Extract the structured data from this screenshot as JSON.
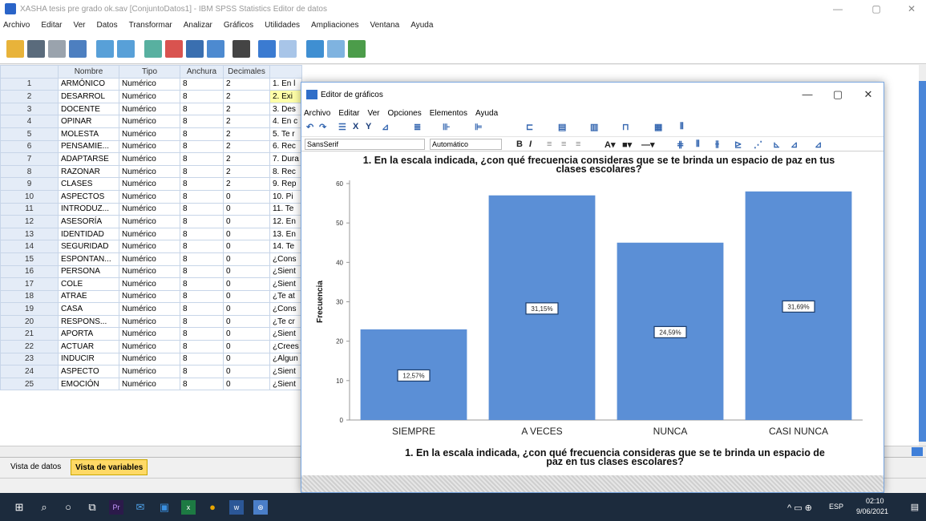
{
  "window": {
    "title": "XASHA tesis pre grado ok.sav [ConjuntoDatos1] - IBM SPSS Statistics Editor de datos",
    "menu": [
      "Archivo",
      "Editar",
      "Ver",
      "Datos",
      "Transformar",
      "Analizar",
      "Gráficos",
      "Utilidades",
      "Ampliaciones",
      "Ventana",
      "Ayuda"
    ]
  },
  "grid": {
    "columns": [
      "Nombre",
      "Tipo",
      "Anchura",
      "Decimales"
    ],
    "rows": [
      {
        "n": "1",
        "name": "ARMÓNICO",
        "type": "Numérico",
        "width": "8",
        "dec": "2",
        "label": "1. En l"
      },
      {
        "n": "2",
        "name": "DESARROL",
        "type": "Numérico",
        "width": "8",
        "dec": "2",
        "label": "2. Exi"
      },
      {
        "n": "3",
        "name": "DOCENTE",
        "type": "Numérico",
        "width": "8",
        "dec": "2",
        "label": "3. Des"
      },
      {
        "n": "4",
        "name": "OPINAR",
        "type": "Numérico",
        "width": "8",
        "dec": "2",
        "label": "4. En c"
      },
      {
        "n": "5",
        "name": "MOLESTA",
        "type": "Numérico",
        "width": "8",
        "dec": "2",
        "label": "5. Te r"
      },
      {
        "n": "6",
        "name": "PENSAMIE...",
        "type": "Numérico",
        "width": "8",
        "dec": "2",
        "label": "6. Rec"
      },
      {
        "n": "7",
        "name": "ADAPTARSE",
        "type": "Numérico",
        "width": "8",
        "dec": "2",
        "label": "7. Dura"
      },
      {
        "n": "8",
        "name": "RAZONAR",
        "type": "Numérico",
        "width": "8",
        "dec": "2",
        "label": "8. Rec"
      },
      {
        "n": "9",
        "name": "CLASES",
        "type": "Numérico",
        "width": "8",
        "dec": "2",
        "label": "9. Rep"
      },
      {
        "n": "10",
        "name": "ASPECTOS",
        "type": "Numérico",
        "width": "8",
        "dec": "0",
        "label": "10. Pi"
      },
      {
        "n": "11",
        "name": "INTRODUZ...",
        "type": "Numérico",
        "width": "8",
        "dec": "0",
        "label": "11. Te"
      },
      {
        "n": "12",
        "name": "ASESORÍA",
        "type": "Numérico",
        "width": "8",
        "dec": "0",
        "label": "12. En"
      },
      {
        "n": "13",
        "name": "IDENTIDAD",
        "type": "Numérico",
        "width": "8",
        "dec": "0",
        "label": "13. En"
      },
      {
        "n": "14",
        "name": "SEGURIDAD",
        "type": "Numérico",
        "width": "8",
        "dec": "0",
        "label": "14. Te"
      },
      {
        "n": "15",
        "name": "ESPONTAN...",
        "type": "Numérico",
        "width": "8",
        "dec": "0",
        "label": "¿Cons"
      },
      {
        "n": "16",
        "name": "PERSONA",
        "type": "Numérico",
        "width": "8",
        "dec": "0",
        "label": "¿Sient"
      },
      {
        "n": "17",
        "name": "COLE",
        "type": "Numérico",
        "width": "8",
        "dec": "0",
        "label": "¿Sient"
      },
      {
        "n": "18",
        "name": "ATRAE",
        "type": "Numérico",
        "width": "8",
        "dec": "0",
        "label": "¿Te at"
      },
      {
        "n": "19",
        "name": "CASA",
        "type": "Numérico",
        "width": "8",
        "dec": "0",
        "label": "¿Cons"
      },
      {
        "n": "20",
        "name": "RESPONS...",
        "type": "Numérico",
        "width": "8",
        "dec": "0",
        "label": "¿Te cr"
      },
      {
        "n": "21",
        "name": "APORTA",
        "type": "Numérico",
        "width": "8",
        "dec": "0",
        "label": "¿Sient"
      },
      {
        "n": "22",
        "name": "ACTUAR",
        "type": "Numérico",
        "width": "8",
        "dec": "0",
        "label": "¿Crees"
      },
      {
        "n": "23",
        "name": "INDUCIR",
        "type": "Numérico",
        "width": "8",
        "dec": "0",
        "label": "¿Algun"
      },
      {
        "n": "24",
        "name": "ASPECTO",
        "type": "Numérico",
        "width": "8",
        "dec": "0",
        "label": "¿Sient"
      },
      {
        "n": "25",
        "name": "EMOCIÓN",
        "type": "Numérico",
        "width": "8",
        "dec": "0",
        "label": "¿Sient"
      }
    ]
  },
  "tabs": {
    "data_view": "Vista de datos",
    "variable_view": "Vista de variables"
  },
  "editor": {
    "title": "Editor de gráficos",
    "menu": [
      "Archivo",
      "Editar",
      "Ver",
      "Opciones",
      "Elementos",
      "Ayuda"
    ],
    "font_name": "SansSerif",
    "font_size": "Automático"
  },
  "chart_data": {
    "type": "bar",
    "title": "1. En la escala indicada, ¿con qué frecuencia consideras que se te brinda un espacio de paz en tus clases escolares?",
    "categories": [
      "SIEMPRE",
      "A VECES",
      "NUNCA",
      "CASI NUNCA"
    ],
    "values": [
      23,
      57,
      45,
      58
    ],
    "data_labels": [
      "12,57%",
      "31,15%",
      "24,59%",
      "31,69%"
    ],
    "ylabel": "Frecuencia",
    "xlabel": "1. En la escala indicada, ¿con qué frecuencia consideras que se te brinda un espacio de paz en tus clases escolares?",
    "ylim": [
      0,
      60
    ],
    "yticks": [
      0,
      10,
      20,
      30,
      40,
      50,
      60
    ],
    "bar_color": "#5b8fd6"
  },
  "taskbar": {
    "lang": "ESP",
    "time": "02:10",
    "date": "9/06/2021"
  }
}
